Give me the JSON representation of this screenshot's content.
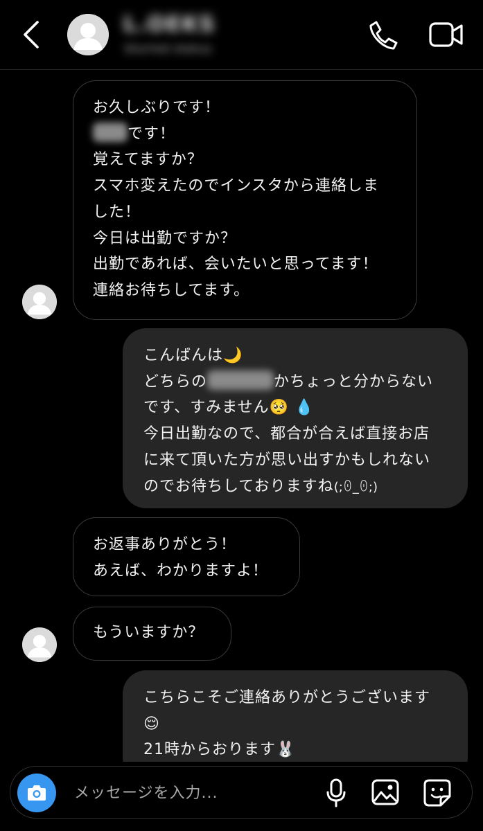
{
  "header": {
    "contact_name": "L.OEKS",
    "contact_status": "blurred status"
  },
  "messages": [
    {
      "direction": "incoming",
      "lines": [
        "お久しぶりです！",
        "です！",
        "覚えてますか？",
        "スマホ変えたのでインスタから連絡しま",
        "した！",
        "今日は出勤ですか？",
        "出勤であれば、会いたいと思ってます！",
        "連絡お待ちしてます。"
      ]
    },
    {
      "direction": "outgoing",
      "lines": [
        "こんばんは",
        "どちらの",
        "かちょっと分からない",
        "です、すみません",
        "今日出勤なので、都合が合えば直接お店",
        "に来て頂いた方が思い出すかもしれない",
        "のでお待ちしておりますね"
      ],
      "emojis": {
        "moon": "🌙",
        "pleading": "🥺",
        "droplet": "💧",
        "kaomoji": "(;ꏿ_ꏿ;)"
      }
    },
    {
      "direction": "incoming",
      "lines": [
        "お返事ありがとう！",
        "あえば、わかりますよ！"
      ]
    },
    {
      "direction": "incoming",
      "lines": [
        "もういますか？"
      ]
    },
    {
      "direction": "outgoing",
      "lines": [
        "こちらこそご連絡ありがとうございます",
        "21時からおります"
      ],
      "emojis": {
        "relieved": "😌",
        "rabbit": "🐰"
      }
    }
  ],
  "composer": {
    "placeholder": "メッセージを入力..."
  },
  "icons": {
    "back": "chevron-left-icon",
    "phone": "phone-icon",
    "video": "video-camera-icon",
    "camera": "camera-icon",
    "mic": "microphone-icon",
    "gallery": "gallery-icon",
    "sticker": "sticker-icon"
  },
  "colors": {
    "background": "#000000",
    "outgoing_bubble": "#262626",
    "incoming_border": "#3a3a3a",
    "accent": "#3797f0"
  }
}
